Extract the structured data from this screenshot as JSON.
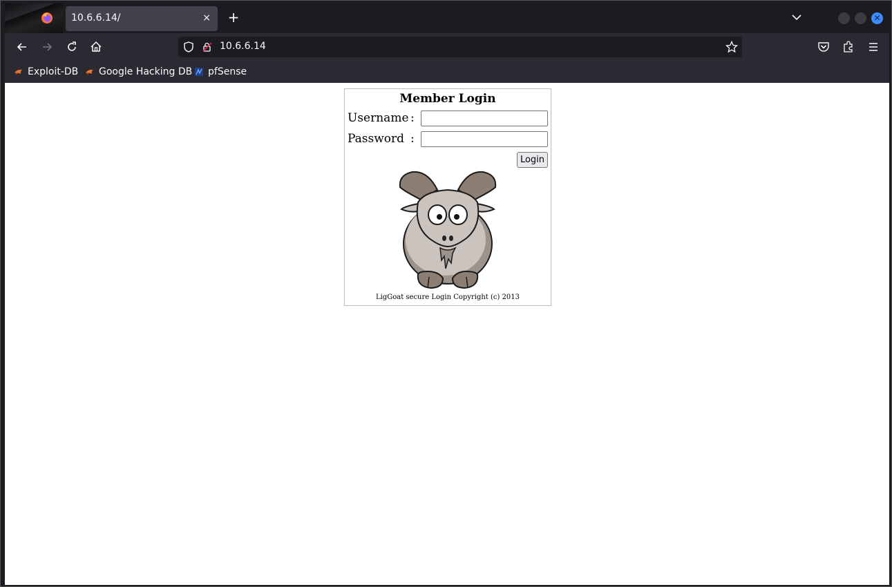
{
  "browser": {
    "tab_title": "10.6.6.14/",
    "tab_close": "×",
    "new_tab": "+",
    "url": "10.6.6.14",
    "accent_color": "#3d8bfd"
  },
  "bookmarks": [
    {
      "label": "Exploit-DB",
      "icon": "exploit-db-icon"
    },
    {
      "label": "Google Hacking DB",
      "icon": "ghdb-icon"
    },
    {
      "label": "pfSense",
      "icon": "pfsense-icon"
    }
  ],
  "login": {
    "title": "Member Login",
    "username_label": "Username",
    "password_label": "Password",
    "colon": ":",
    "username_value": "",
    "password_value": "",
    "button_label": "Login",
    "copyright": "LigGoat secure Login Copyright (c) 2013"
  },
  "icons": {
    "window_close": "✕"
  }
}
